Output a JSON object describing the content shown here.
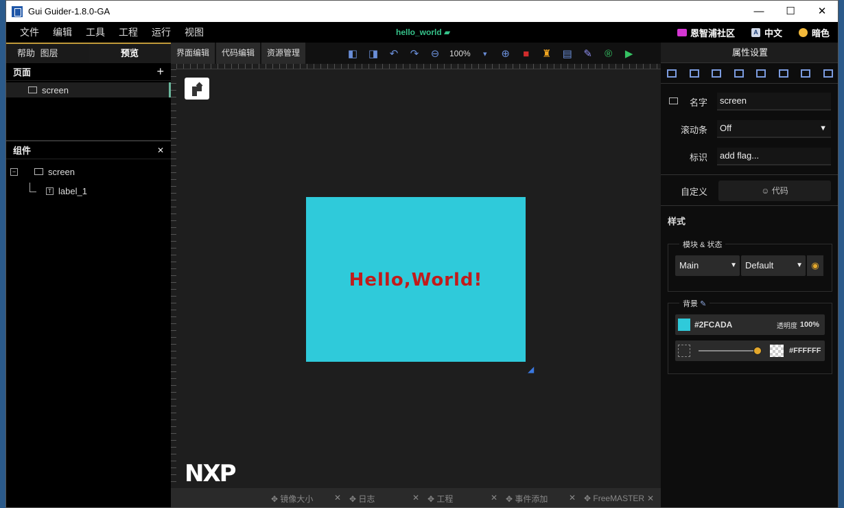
{
  "window": {
    "title": "Gui Guider-1.8.0-GA",
    "controls": [
      "—",
      "☐",
      "✕"
    ]
  },
  "menu": {
    "items": [
      "文件",
      "编辑",
      "工具",
      "工程",
      "运行",
      "视图"
    ],
    "project": "hello_world"
  },
  "menu_right": {
    "community": "恩智浦社区",
    "lang": "中文",
    "lang_icon": "A",
    "theme": "暗色"
  },
  "left": {
    "tabs": [
      "帮助",
      "图层",
      "预览"
    ],
    "pages_title": "页面",
    "add": "+",
    "page_item": "screen",
    "components_title": "组件",
    "collapse": "✕",
    "tree": {
      "screen": "screen",
      "label": "label_1",
      "expander": "−",
      "label_icon": "T"
    }
  },
  "center": {
    "tabs": [
      "界面编辑",
      "代码编辑",
      "资源管理"
    ],
    "zoom": "100%",
    "hello": "Hello,World!",
    "nxp": "NXP",
    "bottom_tabs": [
      "镜像大小",
      "日志",
      "工程",
      "事件添加",
      "FreeMASTER"
    ]
  },
  "right": {
    "title": "属性设置",
    "name_label": "名字",
    "name_value": "screen",
    "scroll_label": "滚动条",
    "scroll_value": "Off",
    "flag_label": "标识",
    "flag_value": "add flag...",
    "custom_label": "自定义",
    "code_button": "代码",
    "style_title": "样式",
    "module_legend": "模块 & 状态",
    "module_value": "Main",
    "state_value": "Default",
    "bg_legend": "背景",
    "bg_color": "#2FCADA",
    "opacity_label": "透明度",
    "opacity_value": "100%",
    "grad_color": "#FFFFFF"
  },
  "colors": {
    "screen_bg": "#2fcada",
    "hello_text": "#c11b1b",
    "accent": "#e3a72b",
    "project_green": "#35c28a"
  }
}
